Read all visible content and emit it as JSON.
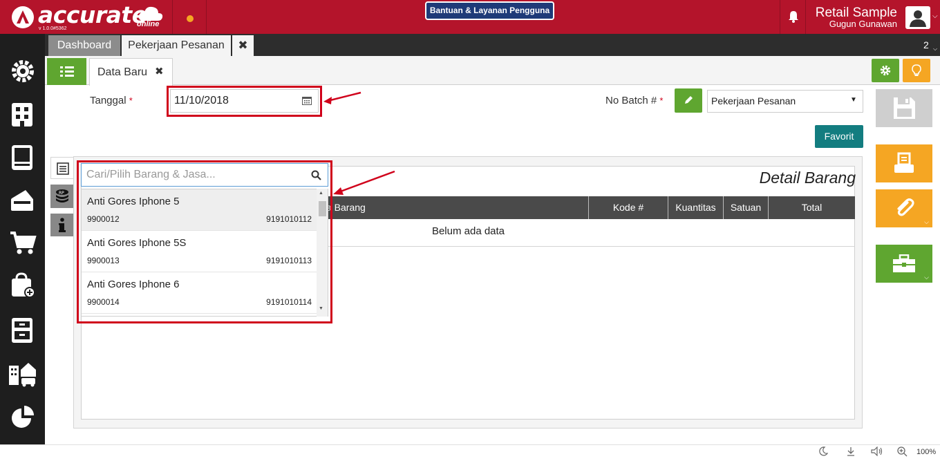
{
  "app": {
    "logo_text": "accurate",
    "logo_sub": "online",
    "version": "v 1.0.0#5362",
    "help_button": "Bantuan & Layanan Pengguna",
    "company": "Retail Sample",
    "user": "Gugun Gunawan",
    "brand_color": "#b4142b"
  },
  "tabs": {
    "dashboard": "Dashboard",
    "active": "Pekerjaan Pesanan",
    "close": "✖",
    "count": "2"
  },
  "form": {
    "tab_label": "Data Baru",
    "tab_close": "✖",
    "tanggal_label": "Tanggal",
    "required_mark": "*",
    "tanggal_value": "11/10/2018",
    "batch_label": "No Batch #",
    "batch_value": "Pekerjaan Pesanan",
    "favorit_label": "Favorit"
  },
  "detail": {
    "title": "Detail Barang",
    "columns": [
      "a Barang",
      "Kode #",
      "Kuantitas",
      "Satuan",
      "Total"
    ],
    "empty_message": "Belum ada data"
  },
  "item_search": {
    "placeholder": "Cari/Pilih Barang & Jasa...",
    "items": [
      {
        "name": "Anti Gores Iphone 5",
        "code": "9900012",
        "barcode": "9191010112"
      },
      {
        "name": "Anti Gores Iphone 5S",
        "code": "9900013",
        "barcode": "9191010113"
      },
      {
        "name": "Anti Gores Iphone 6",
        "code": "9900014",
        "barcode": "9191010114"
      }
    ]
  },
  "statusbar": {
    "zoom": "100%"
  },
  "icons": {
    "sidebar": [
      "settings-icon",
      "company-icon",
      "ledger-icon",
      "payment-icon",
      "cart-icon",
      "purchase-add-icon",
      "inventory-icon",
      "assets-icon",
      "report-chart-icon"
    ],
    "actions": [
      "save-icon",
      "print-icon",
      "attachment-icon",
      "toolbox-icon"
    ]
  },
  "colors": {
    "green": "#5fa630",
    "orange": "#f5a623",
    "teal": "#137d80",
    "highlight_red": "#d0021b"
  }
}
